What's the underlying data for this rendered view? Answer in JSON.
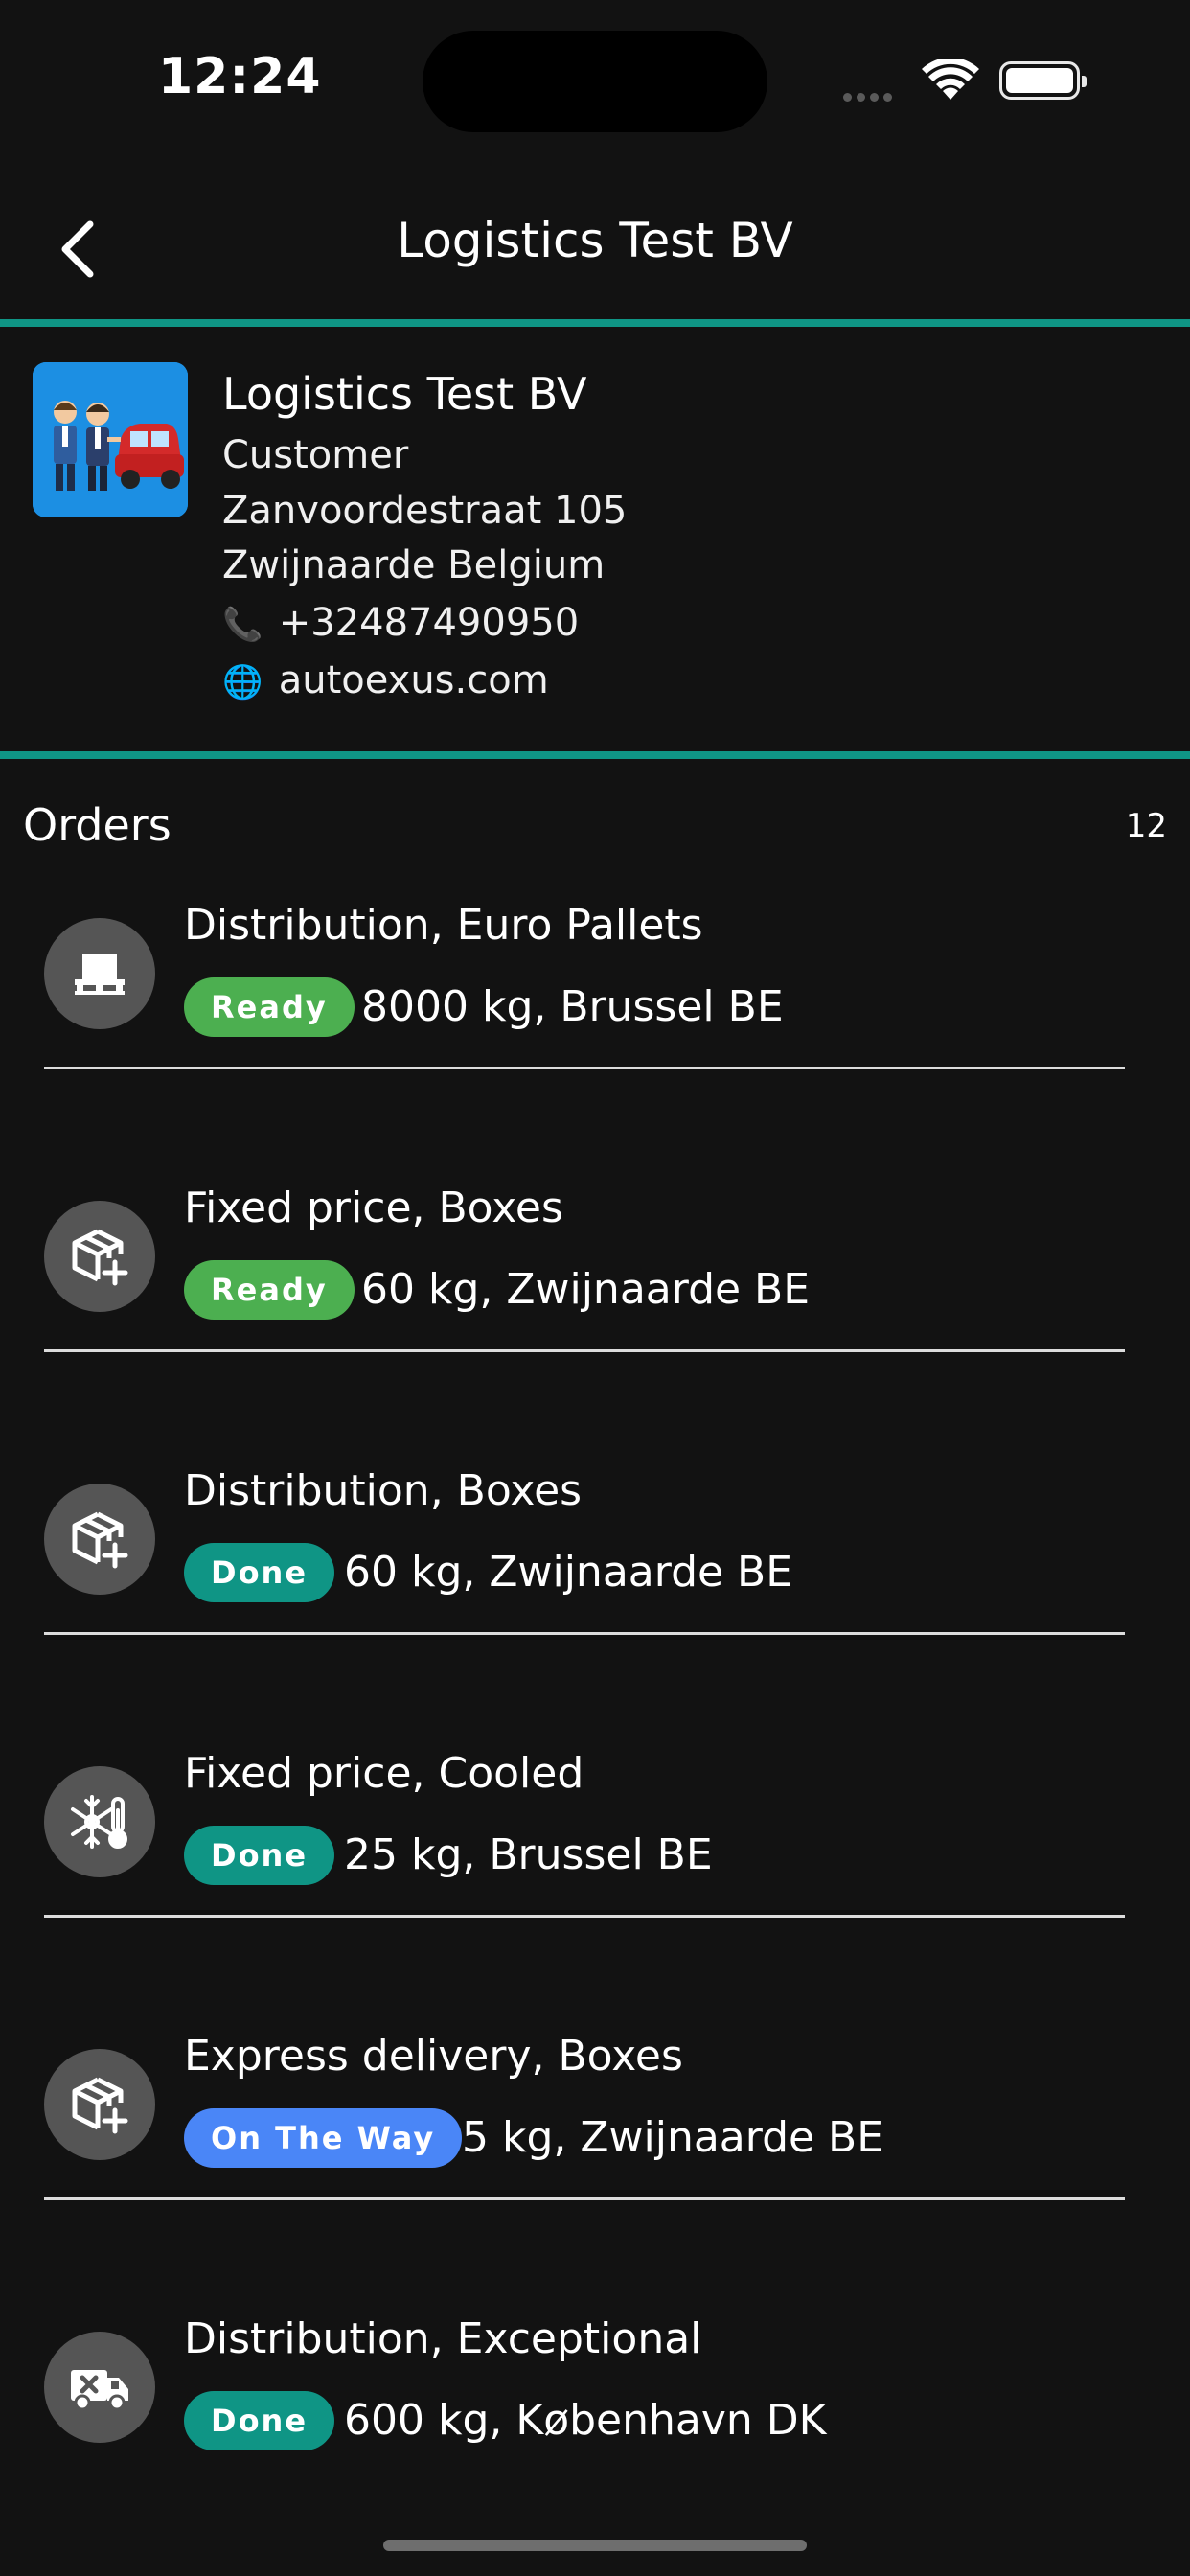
{
  "status_bar": {
    "time": "12:24"
  },
  "nav": {
    "title": "Logistics Test BV"
  },
  "customer": {
    "name": "Logistics Test BV",
    "type": "Customer",
    "street": "Zanvoordestraat 105",
    "city_country": "Zwijnaarde Belgium",
    "phone_icon": "📞",
    "phone": "+32487490950",
    "web_icon": "🌐",
    "website": "autoexus.com"
  },
  "orders": {
    "title": "Orders",
    "count": "12",
    "items": [
      {
        "title": "Distribution, Euro Pallets",
        "status": "Ready",
        "status_color": "#4caf50",
        "detail": "8000 kg, Brussel BE",
        "icon": "pallet-icon"
      },
      {
        "title": "Fixed price, Boxes",
        "status": "Ready",
        "status_color": "#4caf50",
        "detail": "60 kg, Zwijnaarde BE",
        "icon": "box-plus-icon"
      },
      {
        "title": "Distribution, Boxes",
        "status": "Done",
        "status_color": "#0f9585",
        "detail": "60 kg, Zwijnaarde BE",
        "icon": "box-plus-icon"
      },
      {
        "title": "Fixed price, Cooled",
        "status": "Done",
        "status_color": "#0f9585",
        "detail": "25 kg, Brussel BE",
        "icon": "snowflake-thermometer-icon"
      },
      {
        "title": "Express delivery, Boxes",
        "status": "On The Way",
        "status_color": "#4a86f7",
        "detail": "5 kg, Zwijnaarde BE",
        "icon": "box-plus-icon"
      },
      {
        "title": "Distribution, Exceptional",
        "status": "Done",
        "status_color": "#0f9585",
        "detail": "600 kg, København DK",
        "icon": "truck-x-icon"
      }
    ]
  }
}
